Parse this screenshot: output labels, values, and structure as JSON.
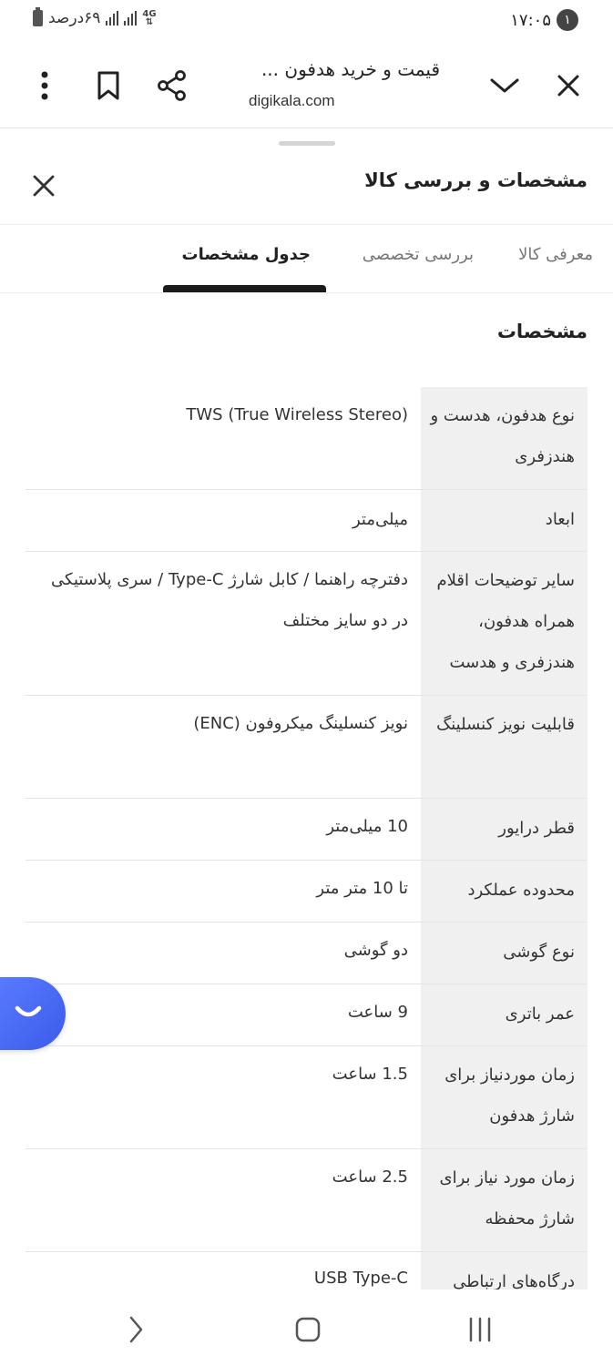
{
  "status_bar": {
    "time": "۱۷:۰۵",
    "notification_count": "۱",
    "battery_percent": "۶۹درصد",
    "network": "4G"
  },
  "browser": {
    "page_title": "قیمت و خرید هدفون ...",
    "url": "digikala.com",
    "icons": [
      "close-icon",
      "chevron-down-icon",
      "share-icon",
      "bookmark-icon",
      "more-vertical-icon"
    ]
  },
  "sheet": {
    "title": "مشخصات و بررسی کالا",
    "tabs": [
      {
        "label": "معرفی کالا",
        "active": false
      },
      {
        "label": "بررسی تخصصی",
        "active": false
      },
      {
        "label": "جدول مشخصات",
        "active": true
      }
    ],
    "section_title": "مشخصات"
  },
  "specs": [
    {
      "key": "نوع هدفون، هدست و هندزفری",
      "value": "TWS (True Wireless Stereo)"
    },
    {
      "key": "ابعاد",
      "value": "میلی‌متر"
    },
    {
      "key": "سایر توضیحات اقلام همراه هدفون، هندزفری و هدست",
      "value": "دفترچه راهنما / کابل شارژ Type-C / سری پلاستیکی در دو سایز مختلف"
    },
    {
      "key": "قابلیت نویز کنسلینگ",
      "value": "نویز کنسلینگ میکروفون (ENC)"
    },
    {
      "key": "قطر درایور",
      "value": "10 میلی‌متر"
    },
    {
      "key": "محدوده عملکرد",
      "value": "تا 10 متر متر"
    },
    {
      "key": "نوع گوشی",
      "value": "دو گوشی"
    },
    {
      "key": "عمر باتری",
      "value": "9 ساعت"
    },
    {
      "key": "زمان موردنیاز برای شارژ هدفون",
      "value": "1.5 ساعت"
    },
    {
      "key": "زمان مورد نیاز برای شارژ محفظه",
      "value": "2.5 ساعت"
    },
    {
      "key": "درگاه‌های ارتباطی",
      "value": "USB Type-C"
    }
  ],
  "colors": {
    "fab_accent": "#4a6cf7",
    "key_cell_bg": "#f0f0f0",
    "active_tab": "#1b1b1b"
  }
}
